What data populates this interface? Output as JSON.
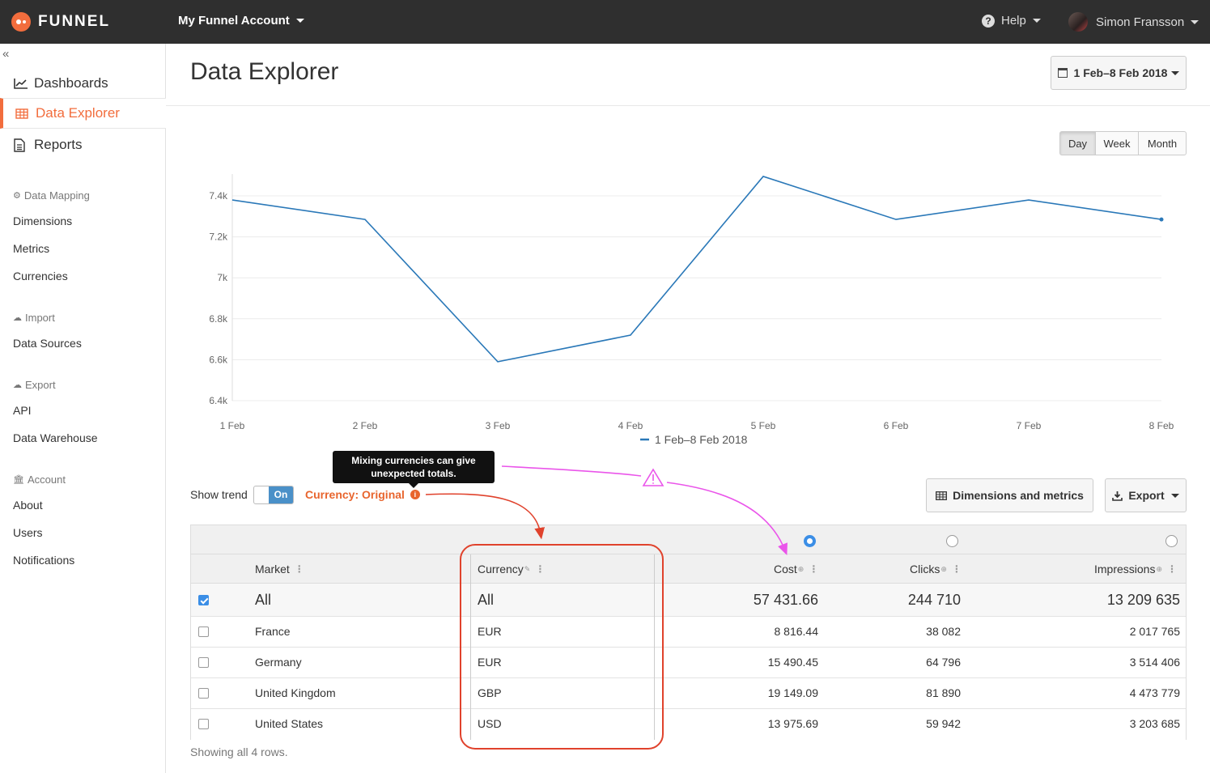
{
  "topbar": {
    "brand": "FUNNEL",
    "account": "My Funnel Account",
    "help": "Help",
    "user": "Simon Fransson"
  },
  "sidebar": {
    "main_items": [
      {
        "label": "Dashboards",
        "icon": "line-chart-icon"
      },
      {
        "label": "Data Explorer",
        "icon": "table-icon",
        "active": true
      },
      {
        "label": "Reports",
        "icon": "document-icon"
      }
    ],
    "sections": [
      {
        "heading": "Data Mapping",
        "icon": "gear-icon",
        "items": [
          "Dimensions",
          "Metrics",
          "Currencies"
        ]
      },
      {
        "heading": "Import",
        "icon": "cloud-upload-icon",
        "items": [
          "Data Sources"
        ]
      },
      {
        "heading": "Export",
        "icon": "cloud-download-icon",
        "items": [
          "API",
          "Data Warehouse"
        ]
      },
      {
        "heading": "Account",
        "icon": "bank-icon",
        "items": [
          "About",
          "Users",
          "Notifications"
        ]
      }
    ]
  },
  "main": {
    "title": "Data Explorer",
    "date_range": "1 Feb–8 Feb 2018",
    "granularity": [
      "Day",
      "Week",
      "Month"
    ],
    "granularity_selected": "Day",
    "show_trend_label": "Show trend",
    "toggle_label": "On",
    "currency_label": "Currency: Original",
    "tooltip": [
      "Mixing currencies can give",
      "unexpected totals."
    ],
    "dimensions_button": "Dimensions and metrics",
    "export_button": "Export",
    "footer": "Showing all 4 rows."
  },
  "table": {
    "columns": {
      "market": "Market",
      "currency": "Currency",
      "cost": "Cost",
      "clicks": "Clicks",
      "impressions": "Impressions"
    },
    "sorted_metric": "Cost",
    "total": {
      "market": "All",
      "currency": "All",
      "cost": "57 431.66",
      "clicks": "244 710",
      "impressions": "13 209 635",
      "checked": true
    },
    "rows": [
      {
        "market": "France",
        "currency": "EUR",
        "cost": "8 816.44",
        "clicks": "38 082",
        "impressions": "2 017 765"
      },
      {
        "market": "Germany",
        "currency": "EUR",
        "cost": "15 490.45",
        "clicks": "64 796",
        "impressions": "3 514 406"
      },
      {
        "market": "United Kingdom",
        "currency": "GBP",
        "cost": "19 149.09",
        "clicks": "81 890",
        "impressions": "4 473 779"
      },
      {
        "market": "United States",
        "currency": "USD",
        "cost": "13 975.69",
        "clicks": "59 942",
        "impressions": "3 203 685"
      }
    ]
  },
  "chart_data": {
    "type": "line",
    "x": [
      "1 Feb",
      "2 Feb",
      "3 Feb",
      "4 Feb",
      "5 Feb",
      "6 Feb",
      "7 Feb",
      "8 Feb"
    ],
    "series": [
      {
        "name": "1 Feb–8 Feb 2018",
        "color": "#2a78b8",
        "values": [
          7380,
          7285,
          6590,
          6720,
          7495,
          7285,
          7380,
          7285
        ]
      }
    ],
    "y_ticks": [
      "6.4k",
      "6.6k",
      "6.8k",
      "7k",
      "7.2k",
      "7.4k"
    ],
    "ylim": [
      6400,
      7400
    ],
    "grid": true,
    "legend": "bottom"
  },
  "colors": {
    "brand": "#f26d3d",
    "topbar": "#2f2f2f",
    "line": "#2a78b8",
    "annotation_red": "#e0422c",
    "annotation_pink": "#ea55ea"
  }
}
